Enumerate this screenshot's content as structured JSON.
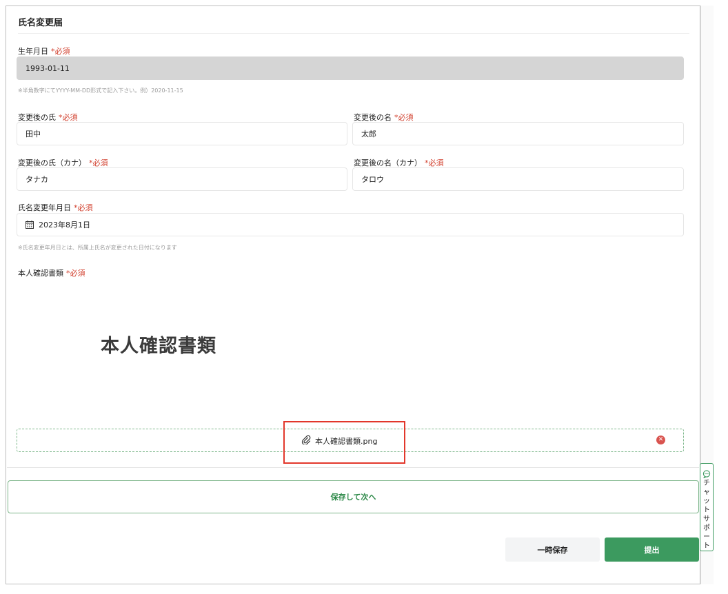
{
  "form": {
    "title": "氏名変更届",
    "required_mark": "*必須",
    "birthdate": {
      "label": "生年月日",
      "value": "1993-01-11",
      "hint": "※半角数字にてYYYY-MM-DD形式で記入下さい。例）2020-11-15"
    },
    "last_name": {
      "label": "変更後の氏",
      "value": "田中"
    },
    "first_name": {
      "label": "変更後の名",
      "value": "太郎"
    },
    "last_name_kana": {
      "label": "変更後の氏（カナ）",
      "value": "タナカ"
    },
    "first_name_kana": {
      "label": "変更後の名（カナ）",
      "value": "タロウ"
    },
    "change_date": {
      "label": "氏名変更年月日",
      "value": "2023年8月1日",
      "hint": "※氏名変更年月日とは、所属上氏名が変更された日付になります",
      "icon": "calendar-icon"
    },
    "id_document": {
      "label": "本人確認書類",
      "preview_text": "本人確認書類",
      "file_name": "本人確認書類.png",
      "attach_icon": "paperclip-icon",
      "remove_icon": "remove-file-icon"
    }
  },
  "actions": {
    "save_next": "保存して次へ",
    "temp_save": "一時保存",
    "submit": "提出"
  },
  "chat_support": {
    "label": "チャットサポート",
    "icon": "chat-bubble-icon"
  },
  "colors": {
    "required": "#d2412f",
    "accent": "#3c9a5f",
    "highlight": "#e2372b"
  }
}
